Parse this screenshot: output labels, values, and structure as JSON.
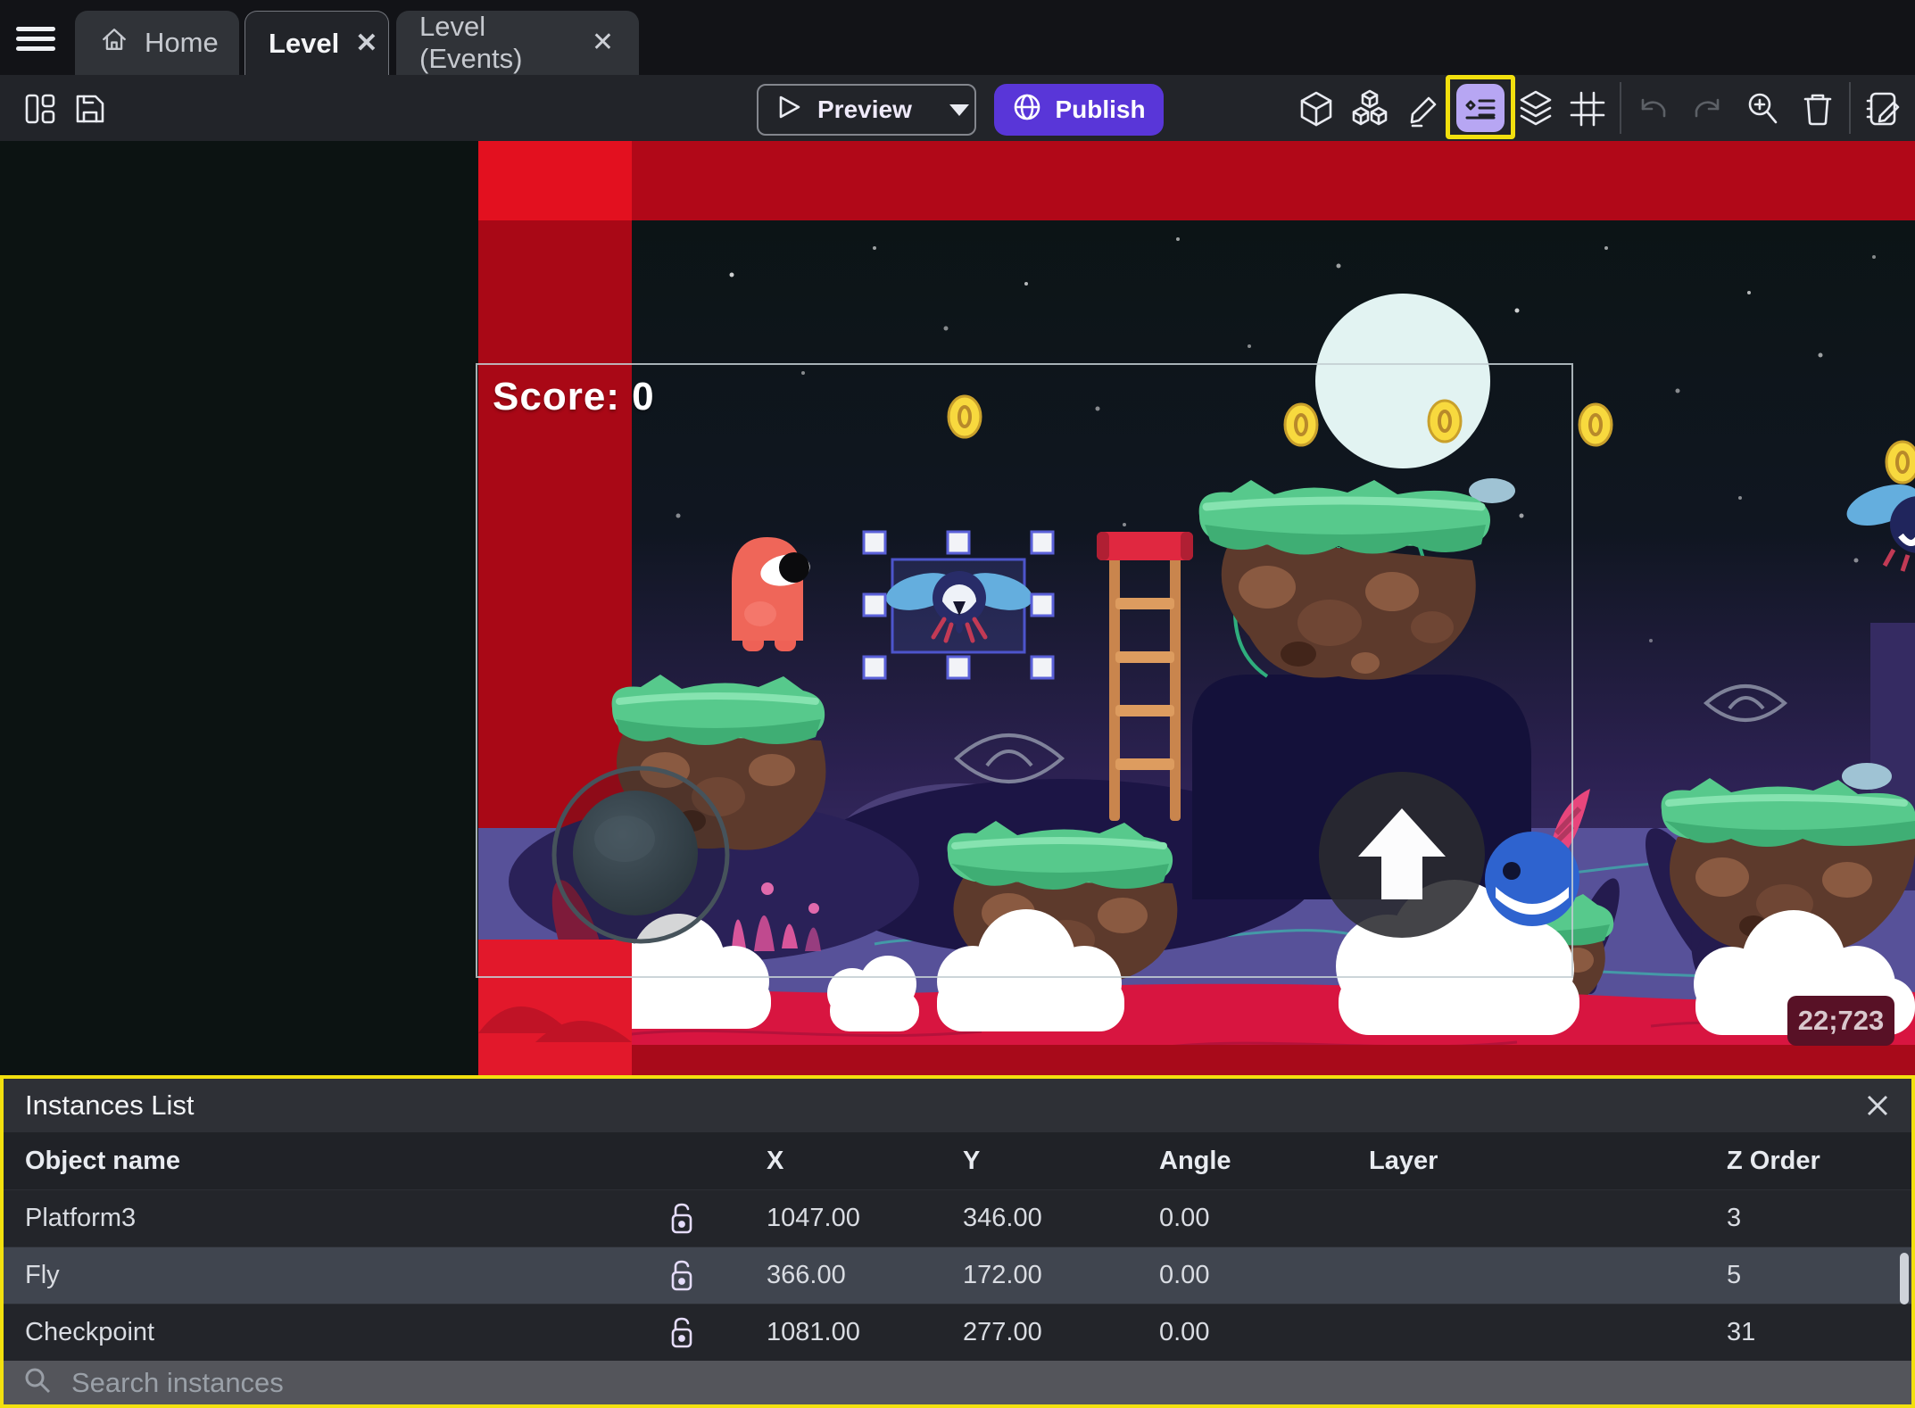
{
  "tabbar": {
    "tabs": [
      {
        "label": "Home"
      },
      {
        "label": "Level"
      },
      {
        "label": "Level (Events)"
      }
    ]
  },
  "toolbar": {
    "preview_label": "Preview",
    "publish_label": "Publish"
  },
  "canvas": {
    "score_label": "Score: 0",
    "cursor_coords": "22;723"
  },
  "panel": {
    "title": "Instances List",
    "columns": [
      "Object name",
      "X",
      "Y",
      "Angle",
      "Layer",
      "Z Order"
    ],
    "rows": [
      {
        "name": "Platform3",
        "x": "1047.00",
        "y": "346.00",
        "angle": "0.00",
        "layer": "",
        "z": "3"
      },
      {
        "name": "Fly",
        "x": "366.00",
        "y": "172.00",
        "angle": "0.00",
        "layer": "",
        "z": "5"
      },
      {
        "name": "Checkpoint",
        "x": "1081.00",
        "y": "277.00",
        "angle": "0.00",
        "layer": "",
        "z": "31"
      }
    ],
    "search_placeholder": "Search instances"
  },
  "colors": {
    "accent_purple": "#5936d8",
    "highlight_yellow": "#f2e00e",
    "selected_row": "#40454f",
    "scene_red": "#b10818"
  }
}
